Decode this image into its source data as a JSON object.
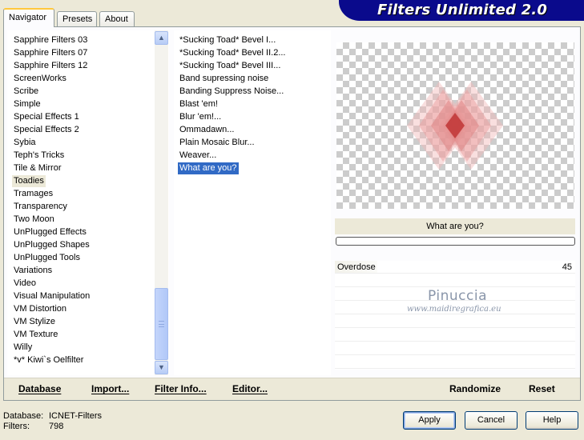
{
  "app": {
    "title": "Filters Unlimited 2.0",
    "tabs": [
      "Navigator",
      "Presets",
      "About"
    ],
    "active_tab": "Navigator"
  },
  "categories": {
    "items": [
      "Sapphire Filters 03",
      "Sapphire Filters 07",
      "Sapphire Filters 12",
      "ScreenWorks",
      "Scribe",
      "Simple",
      "Special Effects 1",
      "Special Effects 2",
      "Sybia",
      "Teph's Tricks",
      "Tile & Mirror",
      "Toadies",
      "Tramages",
      "Transparency",
      "Two Moon",
      "UnPlugged Effects",
      "UnPlugged Shapes",
      "UnPlugged Tools",
      "Variations",
      "Video",
      "Visual Manipulation",
      "VM Distortion",
      "VM Stylize",
      "VM Texture",
      "Willy",
      "*v* Kiwi`s Oelfilter"
    ],
    "selected": "Toadies",
    "scroll_up_glyph": "▲",
    "scroll_down_glyph": "▼"
  },
  "filters": {
    "items": [
      "*Sucking Toad*  Bevel I...",
      "*Sucking Toad*  Bevel II.2...",
      "*Sucking Toad*  Bevel III...",
      "Band supressing noise",
      "Banding Suppress Noise...",
      "Blast 'em!",
      "Blur 'em!...",
      "Ommadawn...",
      "Plain Mosaic Blur...",
      "Weaver...",
      "What are you?"
    ],
    "selected": "What are you?"
  },
  "preview": {
    "filter_name": "What are you?",
    "progress": 0
  },
  "parameters": [
    {
      "name": "Overdose",
      "value": "45",
      "fraction": 0.176
    }
  ],
  "watermark": {
    "line1": "Pinuccia",
    "line2": "www.maidiregrafica.eu"
  },
  "toolbar": {
    "database": "Database",
    "import": "Import...",
    "filter_info": "Filter Info...",
    "editor": "Editor...",
    "randomize": "Randomize",
    "reset": "Reset"
  },
  "status": {
    "database_label": "Database:",
    "database_value": "ICNET-Filters",
    "filters_label": "Filters:",
    "filters_value": "798"
  },
  "buttons": {
    "apply": "Apply",
    "cancel": "Cancel",
    "help": "Help"
  },
  "colors": {
    "banner": "#0a0a8c",
    "selection": "#316ac5",
    "window": "#ece9d8"
  }
}
